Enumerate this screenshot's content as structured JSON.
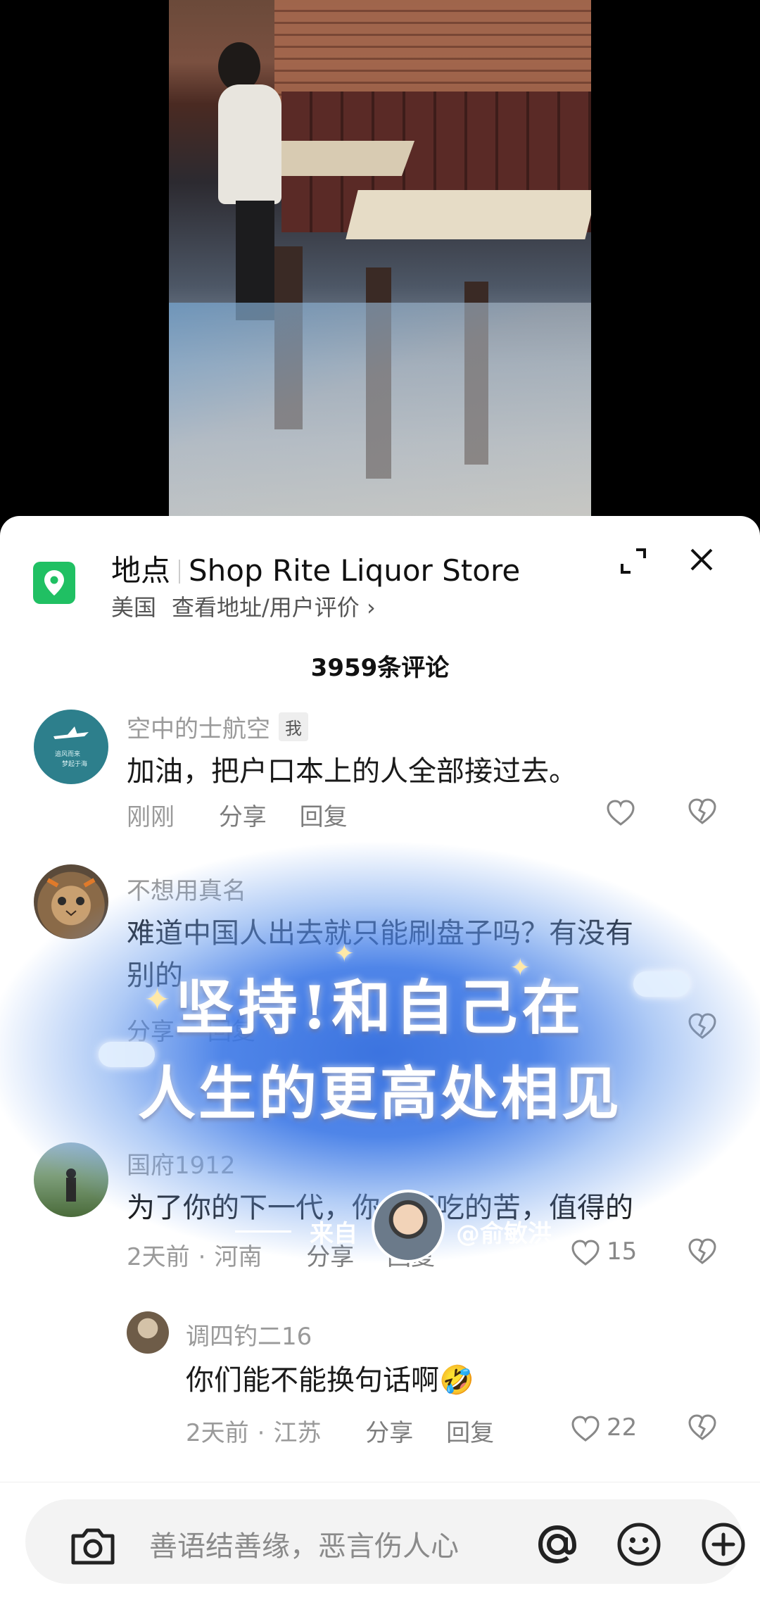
{
  "location": {
    "label": "地点",
    "name": "Shop Rite Liquor Store",
    "country": "美国",
    "link_text": "查看地址/用户评价",
    "chevron": "›"
  },
  "comments_header": {
    "title": "3959条评论"
  },
  "comments": [
    {
      "name": "空中的士航空",
      "badge": "我",
      "text": "加油，把户口本上的人全部接过去。",
      "time": "刚刚",
      "share": "分享",
      "reply": "回复",
      "likes": ""
    },
    {
      "name": "不想用真名",
      "text": "难道中国人出去就只能刷盘子吗？有没有",
      "text2": "别的",
      "share": "分享",
      "reply": "回复"
    },
    {
      "name": "国府1912",
      "text": "为了你的下一代，你今天吃的苦，值得的",
      "time": "2天前",
      "region": "河南",
      "share": "分享",
      "reply": "回复",
      "likes": "15"
    },
    {
      "name": "调四钓二16",
      "text": "你们能不能换句话啊🤣",
      "time": "2天前",
      "region": "江苏",
      "share": "分享",
      "reply": "回复",
      "likes": "22"
    }
  ],
  "overlay": {
    "line1": "坚持!和自己在",
    "line2": "人生的更高处相见",
    "credit_prefix": "来自",
    "credit_handle": "@俞敏洪"
  },
  "input_bar": {
    "placeholder": "善语结善缘，恶言伤人心",
    "icons": [
      "camera-icon",
      "at-icon",
      "emoji-icon",
      "plus-icon"
    ]
  },
  "colors": {
    "pin_green": "#20c063",
    "banner_blue": "#346ede",
    "muted_text": "#9a9a9a"
  }
}
